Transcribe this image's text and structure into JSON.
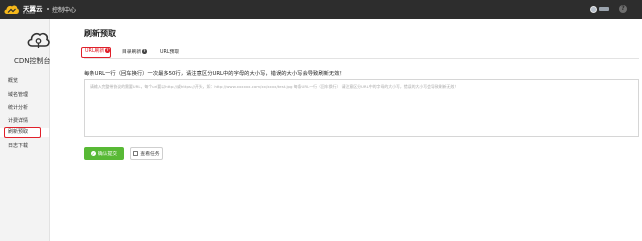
{
  "header": {
    "brand_cn": "天翼云",
    "brand_en": "e Cloud",
    "console_title": "控制中心",
    "help_label": "?"
  },
  "sidebar": {
    "title": "CDN控制台",
    "items": [
      {
        "label": "概览"
      },
      {
        "label": "域名管理"
      },
      {
        "label": "统计分析"
      },
      {
        "label": "计费详情"
      },
      {
        "label": "刷新预取"
      },
      {
        "label": "日志下载"
      }
    ],
    "active_item": "刷新预取"
  },
  "main": {
    "page_title": "刷新预取",
    "tabs": [
      {
        "label": "URL刷新"
      },
      {
        "label": "目录刷新"
      },
      {
        "label": "URL预取"
      }
    ],
    "active_tab": "URL刷新",
    "instruction": "每条URL一行（回车换行）一次最多50行，请注意区分URL中的字母的大小写，错误的大小写会导致刷新无效！",
    "textarea_placeholder": "请输入完整带协议的需要URL，每个url要以http://或https://开头，如：http://www.xxxxxx.com/xx/xxxx/test.jpg 每条URL一行（回车换行） 请注意区分URL中的字母的大小写，错误的大小写会导致刷新无效！",
    "confirm_button": "确认提交",
    "task_button": "查看任务"
  },
  "colors": {
    "topbar": "#2d2d2d",
    "highlight": "#e0202a",
    "primary_green": "#58b935"
  }
}
